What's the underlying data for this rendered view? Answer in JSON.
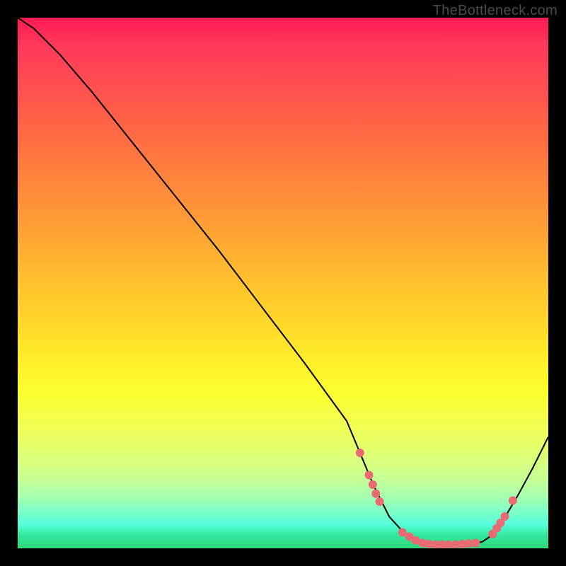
{
  "watermark": "TheBottleneck.com",
  "chart_data": {
    "type": "line",
    "title": "",
    "xlabel": "",
    "ylabel": "",
    "xlim": [
      0,
      100
    ],
    "ylim": [
      0,
      100
    ],
    "grid": false,
    "series": [
      {
        "name": "curve",
        "x": [
          0,
          3,
          8,
          14,
          22,
          30,
          38,
          46,
          54,
          62,
          64.5,
          67,
          70,
          73,
          76,
          79,
          82,
          85,
          87.5,
          89,
          91,
          94,
          97,
          100
        ],
        "y": [
          100,
          98,
          93,
          86,
          76,
          66,
          56,
          45.5,
          35,
          24,
          18,
          12,
          6,
          2.7,
          1.3,
          0.8,
          0.7,
          0.9,
          1.2,
          2.2,
          4.5,
          9.5,
          15,
          21
        ]
      }
    ],
    "markers": [
      {
        "x": 64.5,
        "y": 18
      },
      {
        "x": 66.2,
        "y": 13.8
      },
      {
        "x": 66.9,
        "y": 12
      },
      {
        "x": 67.5,
        "y": 10.3
      },
      {
        "x": 68.2,
        "y": 8.8
      },
      {
        "x": 72.5,
        "y": 3.0
      },
      {
        "x": 73.8,
        "y": 2.2
      },
      {
        "x": 75.0,
        "y": 1.5
      },
      {
        "x": 76.3,
        "y": 1.0
      },
      {
        "x": 77.5,
        "y": 0.8
      },
      {
        "x": 78.8,
        "y": 0.7
      },
      {
        "x": 80.0,
        "y": 0.7
      },
      {
        "x": 81.2,
        "y": 0.7
      },
      {
        "x": 82.5,
        "y": 0.7
      },
      {
        "x": 83.8,
        "y": 0.8
      },
      {
        "x": 85.0,
        "y": 0.9
      },
      {
        "x": 86.3,
        "y": 1.0
      },
      {
        "x": 89.5,
        "y": 2.7
      },
      {
        "x": 90.3,
        "y": 3.8
      },
      {
        "x": 91.0,
        "y": 4.8
      },
      {
        "x": 91.8,
        "y": 6.0
      },
      {
        "x": 93.3,
        "y": 9.0
      }
    ],
    "marker_radius": 6,
    "marker_color": "#e86a72",
    "line_color": "#000000"
  }
}
